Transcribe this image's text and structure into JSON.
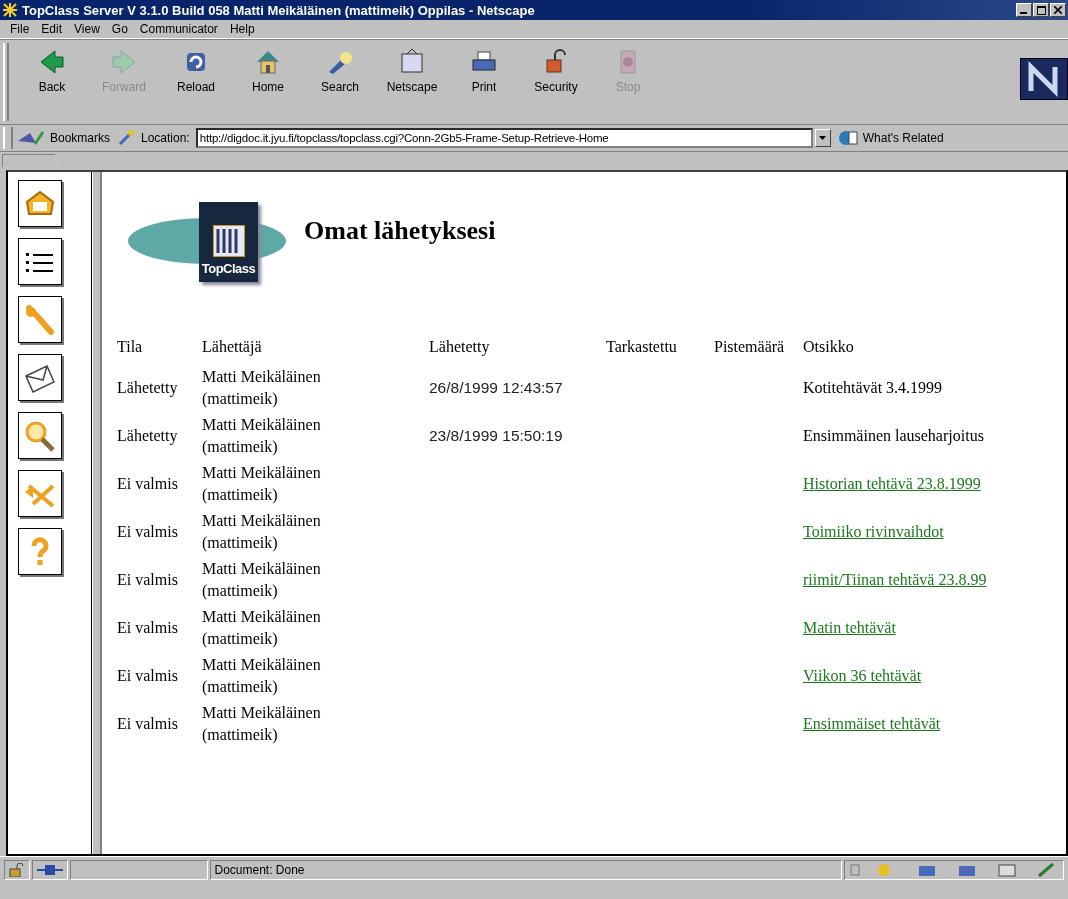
{
  "window": {
    "title": "TopClass Server V 3.1.0 Build 058 Matti Meikäläinen (mattimeik) Oppilas - Netscape"
  },
  "menu": [
    "File",
    "Edit",
    "View",
    "Go",
    "Communicator",
    "Help"
  ],
  "toolbar": [
    {
      "label": "Back",
      "kind": "back",
      "disabled": false
    },
    {
      "label": "Forward",
      "kind": "forward",
      "disabled": true
    },
    {
      "label": "Reload",
      "kind": "reload",
      "disabled": false
    },
    {
      "label": "Home",
      "kind": "home",
      "disabled": false
    },
    {
      "label": "Search",
      "kind": "search",
      "disabled": false
    },
    {
      "label": "Netscape",
      "kind": "netscape",
      "disabled": false
    },
    {
      "label": "Print",
      "kind": "print",
      "disabled": false
    },
    {
      "label": "Security",
      "kind": "security",
      "disabled": false
    },
    {
      "label": "Stop",
      "kind": "stop",
      "disabled": true
    }
  ],
  "location_bar": {
    "bookmarks": "Bookmarks",
    "label": "Location:",
    "url": "http://digdoc.it.jyu.fi/topclass/topclass.cgi?Conn-2Gb5-Frame-Setup-Retrieve-Home",
    "related": "What's Related"
  },
  "sidebar": [
    {
      "kind": "home"
    },
    {
      "kind": "list"
    },
    {
      "kind": "tools"
    },
    {
      "kind": "mail"
    },
    {
      "kind": "search"
    },
    {
      "kind": "exit"
    },
    {
      "kind": "help"
    }
  ],
  "page": {
    "logo": "TopClass",
    "heading": "Omat lähetyksesi",
    "table": {
      "columns": [
        "Tila",
        "Lähettäjä",
        "Lähetetty",
        "Tarkastettu",
        "Pistemäärä",
        "Otsikko"
      ],
      "rows": [
        {
          "status": "Lähetetty",
          "sender": "Matti Meikäläinen (mattimeik)",
          "sent": "26/8/1999 12:43:57",
          "title": "Kotitehtävät 3.4.1999",
          "link": false
        },
        {
          "status": "Lähetetty",
          "sender": "Matti Meikäläinen (mattimeik)",
          "sent": "23/8/1999 15:50:19",
          "title": "Ensimmäinen lauseharjoitus",
          "link": false
        },
        {
          "status": "Ei valmis",
          "sender": "Matti Meikäläinen (mattimeik)",
          "title": "Historian tehtävä 23.8.1999",
          "link": true
        },
        {
          "status": "Ei valmis",
          "sender": "Matti Meikäläinen (mattimeik)",
          "title": "Toimiiko rivinvaihdot",
          "link": true
        },
        {
          "status": "Ei valmis",
          "sender": "Matti Meikäläinen (mattimeik)",
          "title": "riimit/Tiinan tehtävä 23.8.99",
          "link": true
        },
        {
          "status": "Ei valmis",
          "sender": "Matti Meikäläinen (mattimeik)",
          "title": "Matin tehtävät",
          "link": true
        },
        {
          "status": "Ei valmis",
          "sender": "Matti Meikäläinen (mattimeik)",
          "title": "Viikon 36 tehtävät",
          "link": true
        },
        {
          "status": "Ei valmis",
          "sender": "Matti Meikäläinen (mattimeik)",
          "title": "Ensimmäiset tehtävät",
          "link": true
        }
      ]
    }
  },
  "status_bar": {
    "text": "Document: Done"
  }
}
